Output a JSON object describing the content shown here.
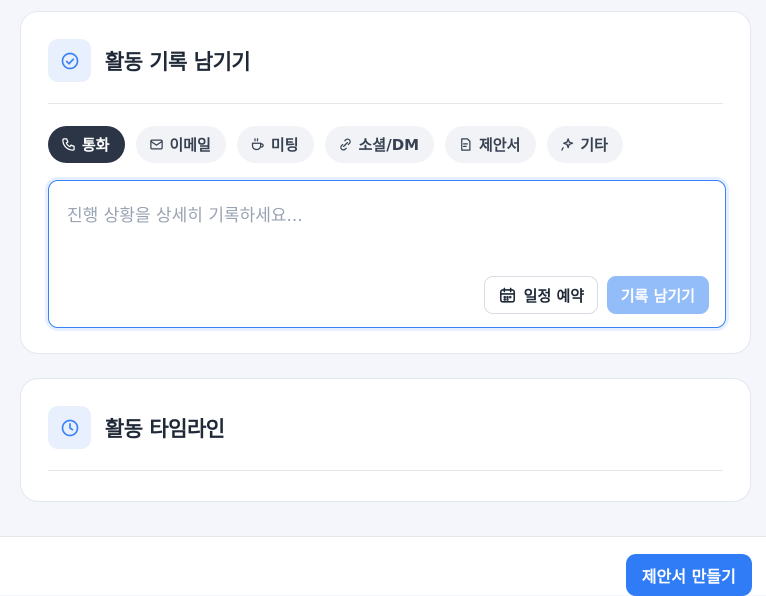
{
  "activity_log": {
    "title": "활동 기록 남기기",
    "header_icon": "check-circle-icon",
    "tabs": [
      {
        "label": "통화",
        "icon": "phone-icon",
        "active": true
      },
      {
        "label": "이메일",
        "icon": "mail-icon",
        "active": false
      },
      {
        "label": "미팅",
        "icon": "coffee-icon",
        "active": false
      },
      {
        "label": "소셜/DM",
        "icon": "link-icon",
        "active": false
      },
      {
        "label": "제안서",
        "icon": "document-icon",
        "active": false
      },
      {
        "label": "기타",
        "icon": "sparkle-icon",
        "active": false
      }
    ],
    "editor": {
      "value": "",
      "placeholder": "진행 상황을 상세히 기록하세요..."
    },
    "schedule_label": "일정 예약",
    "submit_label": "기록 남기기"
  },
  "timeline": {
    "title": "활동 타임라인",
    "header_icon": "clock-icon"
  },
  "footer": {
    "proposal_label": "제안서 만들기"
  },
  "colors": {
    "accent": "#2f7cf6",
    "active_tab": "#2b3546",
    "submit_disabled": "#93bdf8",
    "icon_bg": "#e8f0fd"
  }
}
